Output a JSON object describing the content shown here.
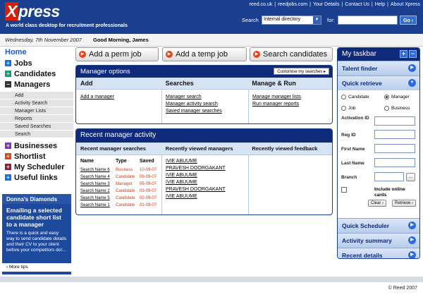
{
  "header": {
    "logo_mark": "X",
    "logo_text": "press",
    "tagline": "A world class desktop for recruitment professionals",
    "links": [
      "reed.co.uk",
      "|",
      "reedjobs.com",
      "|",
      "Your Details",
      "|",
      "Contact Us",
      "|",
      "Help",
      "|",
      "About Xpress"
    ],
    "search_label": "Search",
    "search_select_value": "Internal directory",
    "for_label": "for:",
    "go_label": "Go ›"
  },
  "subbar": {
    "date": "Wednesday, 7th November 2007",
    "greeting": "Good Morning, James"
  },
  "leftnav": {
    "home": "Home",
    "jobs": "Jobs",
    "candidates": "Candidates",
    "managers": "Managers",
    "manager_subs": [
      "Add",
      "Activity Search",
      "Manager Lists",
      "Reports",
      "Saved Searches",
      "Search"
    ],
    "businesses": "Businesses",
    "shortlist": "Shortlist",
    "scheduler": "My Scheduler",
    "useful_links": "Useful links"
  },
  "donna": {
    "heading": "Donna's Diamonds",
    "title": "Emailing a selected candidate short list to a manager",
    "body": "There is a quick and easy way to send candidate details and their CV to your client before your competitors do!...",
    "more": "› More tips"
  },
  "actions": {
    "add_perm": "Add a perm job",
    "add_temp": "Add a temp job",
    "search_candidates": "Search candidates"
  },
  "manager_options": {
    "title": "Manager options",
    "customise": "Customise my searches ▸",
    "col_add": "Add",
    "col_searches": "Searches",
    "col_manage": "Manage & Run",
    "add_links": [
      "Add a manager"
    ],
    "search_links": [
      "Manager search",
      "Manager activity search",
      "Saved manager searches"
    ],
    "manage_links": [
      "Manage manager lists",
      "Run manager reports"
    ]
  },
  "recent": {
    "title": "Recent manager activity",
    "col_searches": "Recent manager searches",
    "col_viewed": "Recently viewed managers",
    "col_feedback": "Recently viewed feedback",
    "hdr_name": "Name",
    "hdr_type": "Type",
    "hdr_saved": "Saved",
    "rows": [
      {
        "name": "Search Name 6",
        "type": "Business",
        "saved": "10-09-07"
      },
      {
        "name": "Search Name 4",
        "type": "Candidate",
        "saved": "09-09-07"
      },
      {
        "name": "Search Name 3",
        "type": "Manager",
        "saved": "05-09-07"
      },
      {
        "name": "Search Name 2",
        "type": "Candidate",
        "saved": "03-09-07"
      },
      {
        "name": "Search Name 5",
        "type": "Candidate",
        "saved": "02-09-07"
      },
      {
        "name": "Search Name 1",
        "type": "Candidate",
        "saved": "01-09-07"
      }
    ],
    "viewed": [
      "IVIE ABUUME",
      "PRAVESH DOORGAKANT",
      "IVIE ABUUME",
      "IVIE ABUUME",
      "PRAVESH DOORGAKANT",
      "IVIE ABUUME"
    ]
  },
  "taskbar": {
    "title": "My taskbar",
    "talent_finder": "Talent finder",
    "quick_retrieve": "Quick retrieve",
    "radio_candidate": "Candidate",
    "radio_manager": "Manager",
    "radio_job": "Job",
    "radio_business": "Business",
    "label_activation": "Activation ID",
    "label_reg": "Reg ID",
    "label_first": "First Name",
    "label_last": "Last Name",
    "label_branch": "Branch",
    "branch_btn": "...",
    "include_online": "Include online cards",
    "clear": "Clear ›",
    "retrieve": "Retrieve ›",
    "quick_scheduler": "Quick Scheduler",
    "activity_summary": "Activity summary",
    "recent_details": "Recent details"
  },
  "footer": {
    "copyright": "© Reed 2007"
  },
  "colors": {
    "brand_blue": "#1a3f8f",
    "accent_red": "#d81e05"
  }
}
